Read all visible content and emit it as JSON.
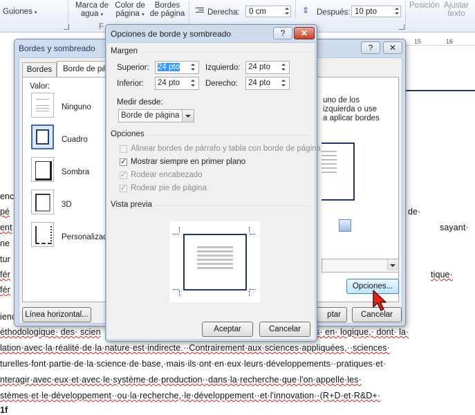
{
  "ribbon": {
    "left_label": "Guiones",
    "watermark_l1": "Marca de",
    "watermark_l2": "agua",
    "pagecolor_l1": "Color de",
    "pagecolor_l2": "página",
    "borders_l1": "Bordes",
    "borders_l2": "de página",
    "group_short": "F",
    "right_indent_label": "Derecha:",
    "right_indent_value": "0 cm",
    "after_label": "Después:",
    "after_value": "10 pto",
    "position_label": "Posición",
    "wrap_l1": "Ajustar",
    "wrap_l2": "texto"
  },
  "ruler": {
    "mark_15": "15",
    "mark_16": "16"
  },
  "back_dialog": {
    "title": "Bordes y sombreado",
    "help": "?",
    "close": "✕",
    "tab1": "Bordes",
    "tab2": "Borde de pág",
    "value_label": "Valor:",
    "settings": [
      "Ninguno",
      "Cuadro",
      "Sombra",
      "3D",
      "Personalizado"
    ],
    "right_text_1": "uno de los",
    "right_text_2": "izquierda o use",
    "right_text_3": "a aplicar bordes",
    "horizontal_button": "Línea horizontal...",
    "options_button": "Opciones...",
    "accept_partial": "ptar",
    "cancel_button": "Cancelar"
  },
  "dialog": {
    "title": "Opciones de borde y sombreado",
    "help": "?",
    "close": "✕",
    "margin_group": "Margen",
    "top_label": "Superior:",
    "top_value": "24 pto",
    "bottom_label": "Inferior:",
    "bottom_value": "24 pto",
    "left_label": "Izquierdo:",
    "left_value": "24 pto",
    "right_label": "Derecho:",
    "right_value": "24 pto",
    "measure_label": "Medir desde:",
    "measure_value": "Borde de página",
    "options_group": "Opciones",
    "opt_align": "Alinear bordes de párrafo y tabla con borde de página",
    "opt_front": "Mostrar siempre en primer plano",
    "opt_header": "Rodear encabezado",
    "opt_footer": "Rodear pie de página",
    "preview_group": "Vista previa",
    "accept_button": "Aceptar",
    "cancel_button": "Cancelar"
  },
  "document": {
    "left_fragments": [
      "enc",
      "pé",
      "ent",
      "ne",
      "tur",
      "fér",
      "fér"
    ],
    "right_fragments": [
      "de·",
      "sayant·",
      "tique·"
    ],
    "line_para": "ienc",
    "line1_left": "éthodologique· des· scien",
    "line1_right": "s· en· logique,· dont· la·",
    "line2": "lation·avec·la·réalité·de·la·nature·est·indirecte.··Contrairement·aux·sciences·appliquées,··sciences·",
    "line3": "turelles·font·partie·de·la·science·de·base,·mais·ils·ont·en·eux·leurs·développements··pratiques·et·",
    "line4": "nteragir·avec·eux·et·avec·le·système·de·production··dans·la·recherche·que·l'on·appelle·les·",
    "line5": "stèmes·et·le·développement··ou·la·recherche,·le·développement··et·l'innovation··(R+D·et·R&D+·",
    "line6": "1f"
  }
}
